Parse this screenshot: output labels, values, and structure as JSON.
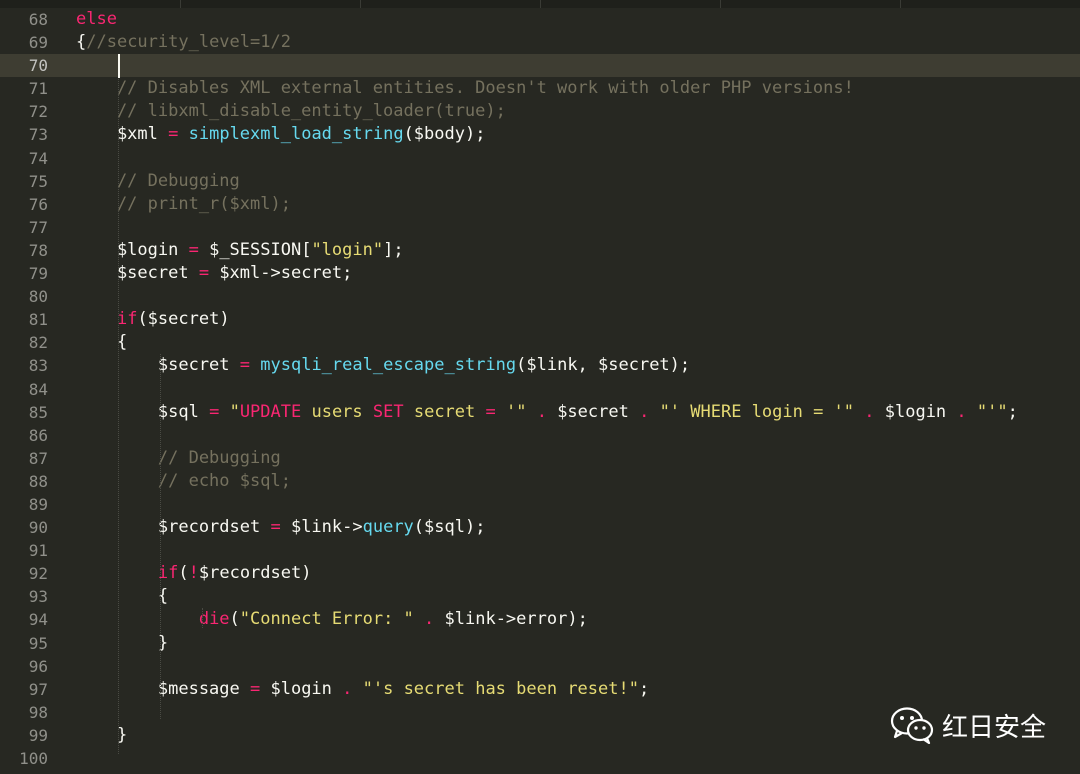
{
  "editor": {
    "theme_colors": {
      "background": "#272822",
      "keyword": "#f92672",
      "function": "#66d9ef",
      "string": "#e6db74",
      "comment": "#75715e",
      "text": "#f8f8f2"
    },
    "current_line": "70",
    "lines": [
      {
        "n": "68",
        "tokens": [
          {
            "t": "else",
            "c": "kw"
          }
        ]
      },
      {
        "n": "69",
        "tokens": [
          {
            "t": "{",
            "c": "var"
          },
          {
            "t": "//security_level=1/2",
            "c": "cmt"
          }
        ]
      },
      {
        "n": "70",
        "tokens": []
      },
      {
        "n": "71",
        "tokens": [
          {
            "t": "    // Disables XML external entities. Doesn't work with older PHP versions!",
            "c": "cmt"
          }
        ]
      },
      {
        "n": "72",
        "tokens": [
          {
            "t": "    // libxml_disable_entity_loader(true);",
            "c": "cmt"
          }
        ]
      },
      {
        "n": "73",
        "tokens": [
          {
            "t": "    $xml ",
            "c": "var"
          },
          {
            "t": "=",
            "c": "op"
          },
          {
            "t": " ",
            "c": "var"
          },
          {
            "t": "simplexml_load_string",
            "c": "fn"
          },
          {
            "t": "($body);",
            "c": "var"
          }
        ]
      },
      {
        "n": "74",
        "tokens": []
      },
      {
        "n": "75",
        "tokens": [
          {
            "t": "    // Debugging",
            "c": "cmt"
          }
        ]
      },
      {
        "n": "76",
        "tokens": [
          {
            "t": "    // print_r($xml);",
            "c": "cmt"
          }
        ]
      },
      {
        "n": "77",
        "tokens": []
      },
      {
        "n": "78",
        "tokens": [
          {
            "t": "    $login ",
            "c": "var"
          },
          {
            "t": "=",
            "c": "op"
          },
          {
            "t": " $_SESSION[",
            "c": "var"
          },
          {
            "t": "\"login\"",
            "c": "str"
          },
          {
            "t": "];",
            "c": "var"
          }
        ]
      },
      {
        "n": "79",
        "tokens": [
          {
            "t": "    $secret ",
            "c": "var"
          },
          {
            "t": "=",
            "c": "op"
          },
          {
            "t": " $xml->secret;",
            "c": "var"
          }
        ]
      },
      {
        "n": "80",
        "tokens": []
      },
      {
        "n": "81",
        "tokens": [
          {
            "t": "    ",
            "c": "var"
          },
          {
            "t": "if",
            "c": "kw"
          },
          {
            "t": "($secret)",
            "c": "var"
          }
        ]
      },
      {
        "n": "82",
        "tokens": [
          {
            "t": "    {",
            "c": "var"
          }
        ]
      },
      {
        "n": "83",
        "tokens": [
          {
            "t": "        $secret ",
            "c": "var"
          },
          {
            "t": "=",
            "c": "op"
          },
          {
            "t": " ",
            "c": "var"
          },
          {
            "t": "mysqli_real_escape_string",
            "c": "fn"
          },
          {
            "t": "($link, $secret);",
            "c": "var"
          }
        ]
      },
      {
        "n": "84",
        "tokens": []
      },
      {
        "n": "85",
        "tokens": [
          {
            "t": "        $sql ",
            "c": "var"
          },
          {
            "t": "=",
            "c": "op"
          },
          {
            "t": " ",
            "c": "var"
          },
          {
            "t": "\"",
            "c": "str"
          },
          {
            "t": "UPDATE",
            "c": "kw"
          },
          {
            "t": " users ",
            "c": "str"
          },
          {
            "t": "SET",
            "c": "kw"
          },
          {
            "t": " secret ",
            "c": "str"
          },
          {
            "t": "=",
            "c": "op"
          },
          {
            "t": " '\"",
            "c": "str"
          },
          {
            "t": " . ",
            "c": "op"
          },
          {
            "t": "$secret",
            "c": "var"
          },
          {
            "t": " . ",
            "c": "op"
          },
          {
            "t": "\"' WHERE login = '\"",
            "c": "str"
          },
          {
            "t": " . ",
            "c": "op"
          },
          {
            "t": "$login",
            "c": "var"
          },
          {
            "t": " . ",
            "c": "op"
          },
          {
            "t": "\"'\"",
            "c": "str"
          },
          {
            "t": ";",
            "c": "var"
          }
        ]
      },
      {
        "n": "86",
        "tokens": []
      },
      {
        "n": "87",
        "tokens": [
          {
            "t": "        // Debugging",
            "c": "cmt"
          }
        ]
      },
      {
        "n": "88",
        "tokens": [
          {
            "t": "        // echo $sql;",
            "c": "cmt"
          }
        ]
      },
      {
        "n": "89",
        "tokens": []
      },
      {
        "n": "90",
        "tokens": [
          {
            "t": "        $recordset ",
            "c": "var"
          },
          {
            "t": "=",
            "c": "op"
          },
          {
            "t": " $link->",
            "c": "var"
          },
          {
            "t": "query",
            "c": "fn"
          },
          {
            "t": "($sql);",
            "c": "var"
          }
        ]
      },
      {
        "n": "91",
        "tokens": []
      },
      {
        "n": "92",
        "tokens": [
          {
            "t": "        ",
            "c": "var"
          },
          {
            "t": "if",
            "c": "kw"
          },
          {
            "t": "(",
            "c": "var"
          },
          {
            "t": "!",
            "c": "op"
          },
          {
            "t": "$recordset)",
            "c": "var"
          }
        ]
      },
      {
        "n": "93",
        "tokens": [
          {
            "t": "        {",
            "c": "var"
          }
        ]
      },
      {
        "n": "94",
        "tokens": [
          {
            "t": "            ",
            "c": "var"
          },
          {
            "t": "die",
            "c": "kw"
          },
          {
            "t": "(",
            "c": "var"
          },
          {
            "t": "\"Connect Error: \"",
            "c": "str"
          },
          {
            "t": " . ",
            "c": "op"
          },
          {
            "t": "$link->error);",
            "c": "var"
          }
        ]
      },
      {
        "n": "95",
        "tokens": [
          {
            "t": "        }",
            "c": "var"
          }
        ]
      },
      {
        "n": "96",
        "tokens": []
      },
      {
        "n": "97",
        "tokens": [
          {
            "t": "        $message ",
            "c": "var"
          },
          {
            "t": "=",
            "c": "op"
          },
          {
            "t": " $login",
            "c": "var"
          },
          {
            "t": " . ",
            "c": "op"
          },
          {
            "t": "\"'s secret has been reset!\"",
            "c": "str"
          },
          {
            "t": ";",
            "c": "var"
          }
        ]
      },
      {
        "n": "98",
        "tokens": []
      },
      {
        "n": "99",
        "tokens": [
          {
            "t": "    }",
            "c": "var"
          }
        ]
      },
      {
        "n": "100",
        "tokens": []
      }
    ]
  },
  "watermark": {
    "icon": "wechat-icon",
    "text": "红日安全"
  }
}
